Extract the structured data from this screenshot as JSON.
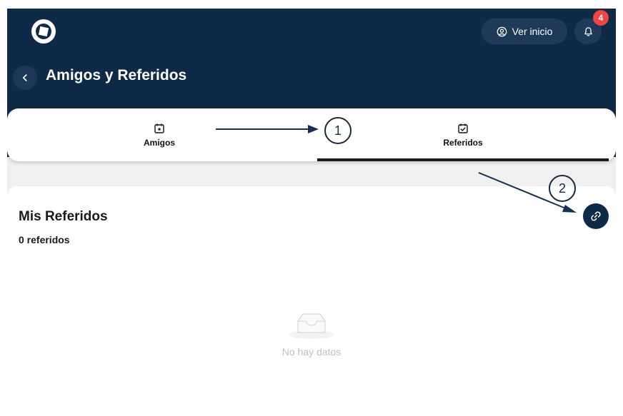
{
  "header": {
    "ver_inicio_label": "Ver inicio",
    "notification_count": "4",
    "title": "Amigos y Referidos"
  },
  "tabs": [
    {
      "label": "Amigos",
      "active": false,
      "icon": "calendar-star-icon"
    },
    {
      "label": "Referidos",
      "active": true,
      "icon": "calendar-check-icon"
    }
  ],
  "card": {
    "title": "Mis Referidos",
    "count": "0 referidos",
    "empty_text": "No hay datos"
  },
  "annotations": [
    "1",
    "2"
  ],
  "colors": {
    "header_bg": "#0e2a47",
    "badge": "#ef4444",
    "tab_underline": "#1b1b1b"
  }
}
